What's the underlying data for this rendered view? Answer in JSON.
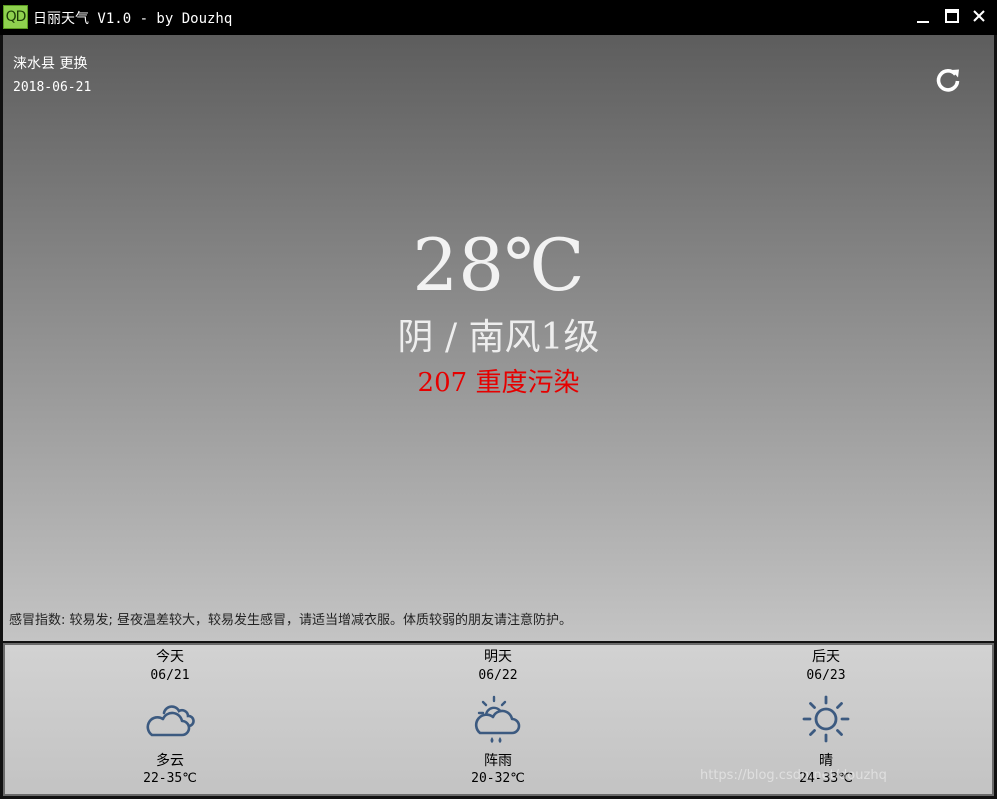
{
  "window": {
    "icon_text": "QD",
    "title": "日丽天气 V1.0 - by Douzhq",
    "icons": {
      "minimize": "minimize-icon",
      "maximize": "maximize-icon",
      "close": "close-icon"
    }
  },
  "current": {
    "city": "涞水县",
    "change_label": "更换",
    "date": "2018-06-21",
    "refresh_icon": "refresh-icon",
    "temperature": "28℃",
    "condition": "阴 / 南风1级",
    "aqi": "207 重度污染",
    "aqi_color": "#e60000",
    "advice": "感冒指数: 较易发; 昼夜温差较大，较易发生感冒，请适当增减衣服。体质较弱的朋友请注意防护。"
  },
  "forecast": [
    {
      "label": "今天",
      "date": "06/21",
      "icon": "cloudy-icon",
      "desc": "多云",
      "range": "22-35℃"
    },
    {
      "label": "明天",
      "date": "06/22",
      "icon": "shower-icon",
      "desc": "阵雨",
      "range": "20-32℃"
    },
    {
      "label": "后天",
      "date": "06/23",
      "icon": "sunny-icon",
      "desc": "晴",
      "range": "24-33℃"
    }
  ],
  "watermark": "https://blog.csdn.net/douzhq",
  "colors": {
    "icon_blue": "#3c5a80"
  }
}
